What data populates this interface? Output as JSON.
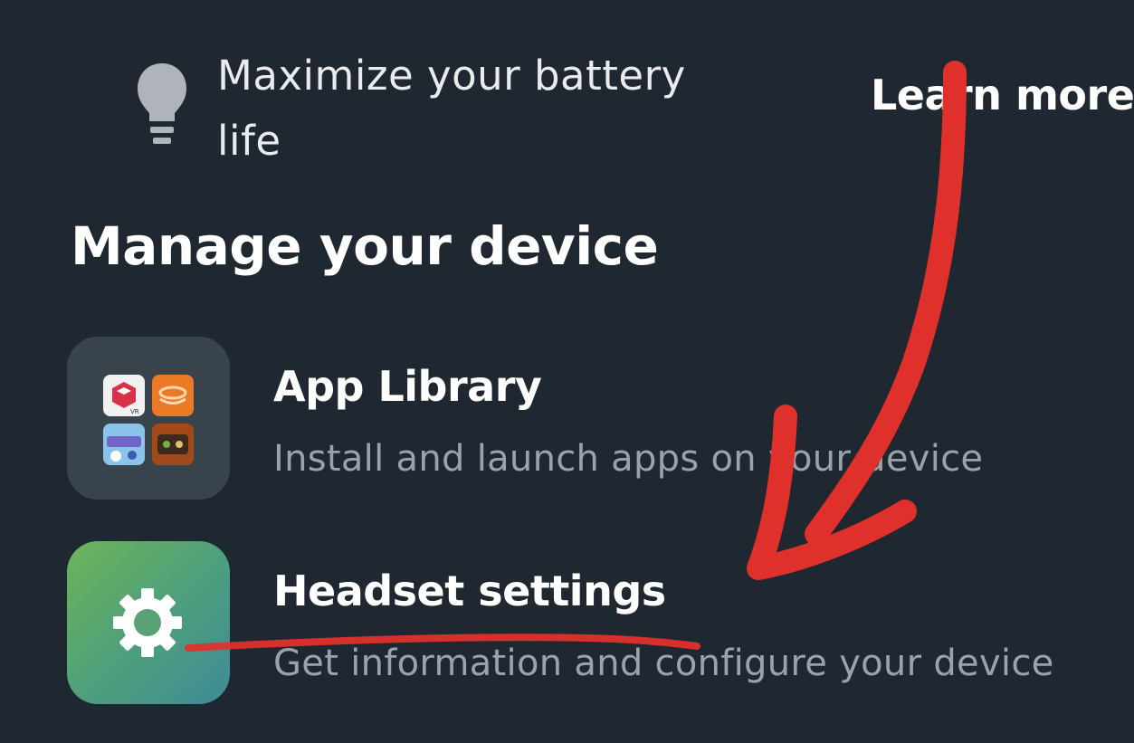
{
  "tip": {
    "icon": "lightbulb-icon",
    "text": "Maximize your battery life",
    "link_label": "Learn more"
  },
  "section": {
    "title": "Manage your device"
  },
  "items": [
    {
      "icon": "app-library-icon",
      "title": "App Library",
      "description": "Install and launch apps on your device"
    },
    {
      "icon": "gear-icon",
      "title": "Headset settings",
      "description": "Get information and configure your device"
    }
  ],
  "colors": {
    "background": "#1f2830",
    "annotation_red": "#e0302b",
    "settings_tile_start": "#6db45a",
    "settings_tile_end": "#3d8b98"
  }
}
